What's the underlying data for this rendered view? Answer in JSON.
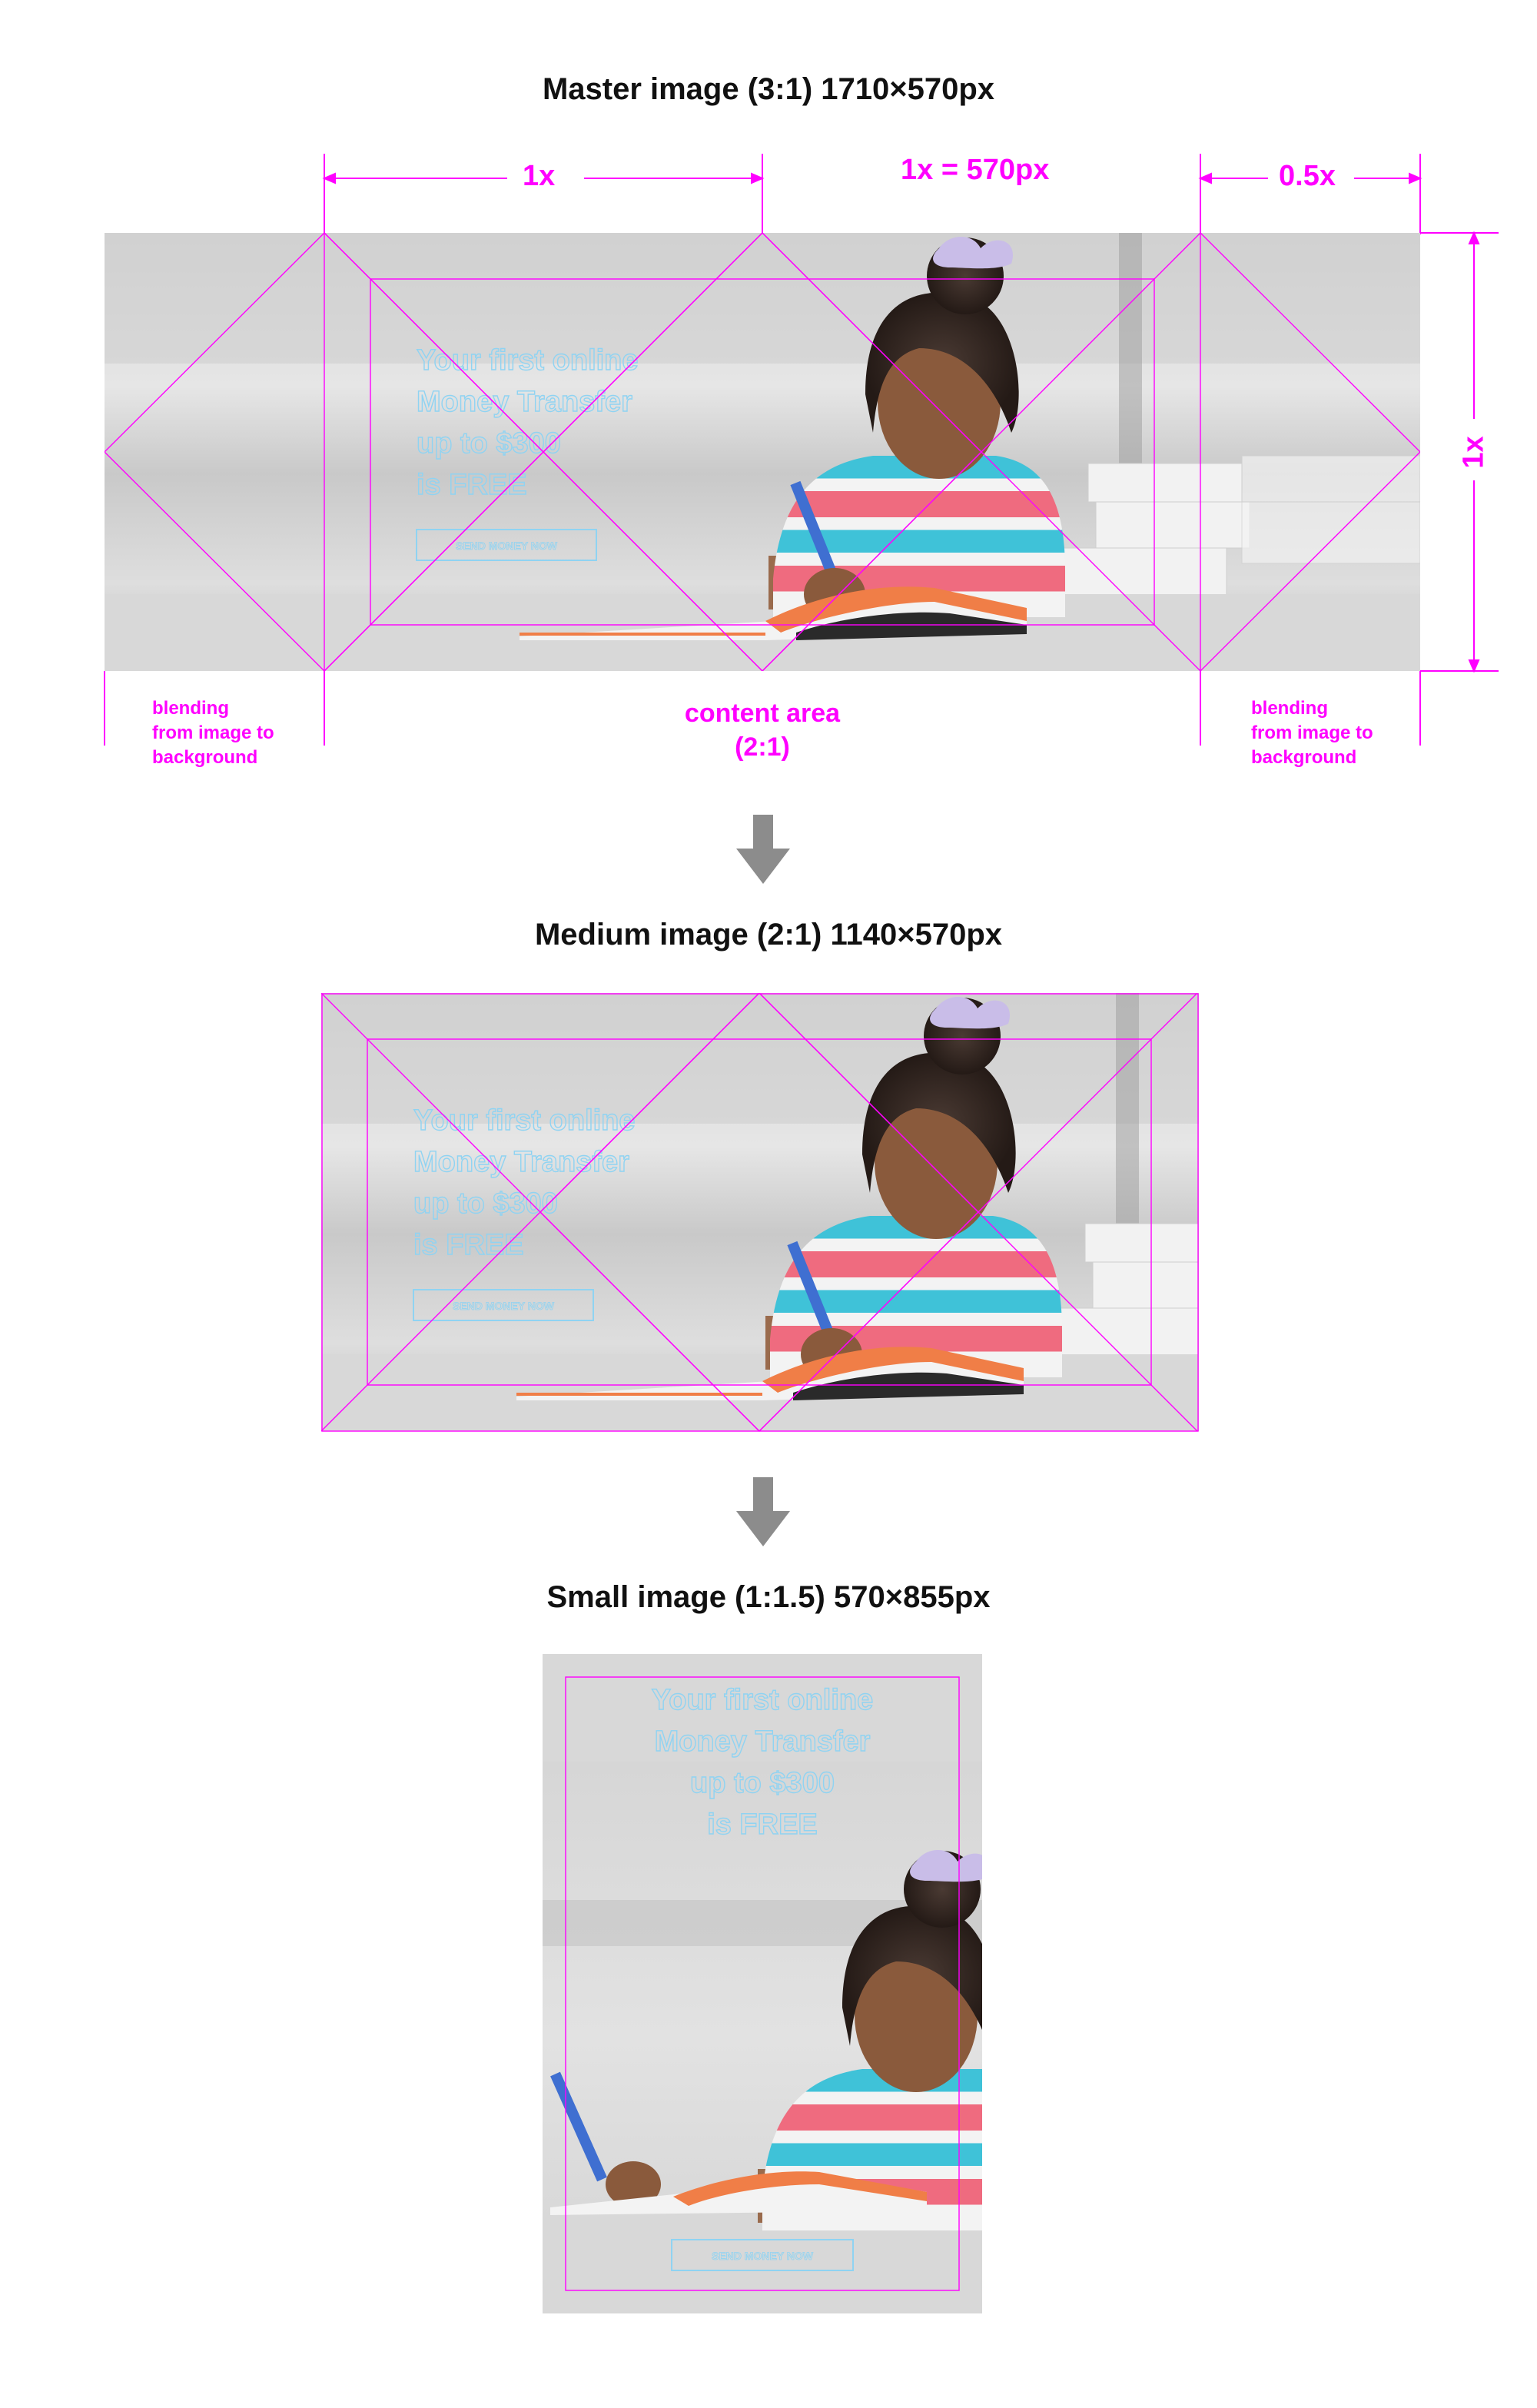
{
  "titles": {
    "master": "Master image (3:1) 1710×570px",
    "medium": "Medium image (2:1) 1140×570px",
    "small": "Small image (1:1.5) 570×855px"
  },
  "dimensions": {
    "width_left": "1x",
    "width_mid": "1x = 570px",
    "width_right": "0.5x",
    "height": "1x"
  },
  "labels": {
    "blend_left": [
      "blending",
      "from image to",
      "background"
    ],
    "blend_right": [
      "blending",
      "from image to",
      "background"
    ],
    "content_area": [
      "content area",
      "(2:1)"
    ]
  },
  "banner": {
    "headline": [
      "Your first online",
      "Money Transfer",
      "up to $300",
      "is FREE"
    ],
    "cta": "SEND MONEY NOW"
  },
  "colors": {
    "guide": "#ff00ff",
    "outline_text": "#8fd3f2",
    "arrow": "#8c8c8c"
  },
  "icons": [
    "down-arrow-icon",
    "down-arrow-icon"
  ]
}
